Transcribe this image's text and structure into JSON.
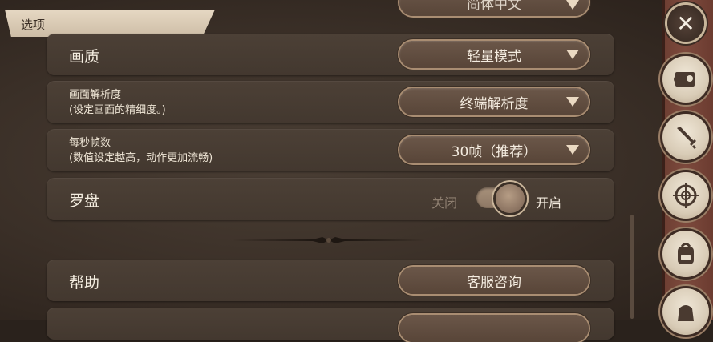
{
  "header": {
    "tab_label": "选项"
  },
  "rows": [
    {
      "title": "简体中文",
      "partial": true
    },
    {
      "title": "画质",
      "value": "轻量模式"
    },
    {
      "title": "画面解析度",
      "subtitle": "(设定画面的精细度。)",
      "value": "终端解析度"
    },
    {
      "title": "每秒帧数",
      "subtitle": "(数值设定越高，动作更加流畅)",
      "value": "30帧（推荐）"
    },
    {
      "title": "罗盘",
      "off_label": "关闭",
      "on_label": "开启",
      "state": "on"
    },
    {
      "title": "帮助",
      "button": "客服咨询"
    }
  ],
  "sidebar": {
    "close": "✕",
    "icons": [
      "map-scroll-icon",
      "sword-icon",
      "crosshair-icon",
      "backpack-icon",
      "bag-icon"
    ]
  }
}
